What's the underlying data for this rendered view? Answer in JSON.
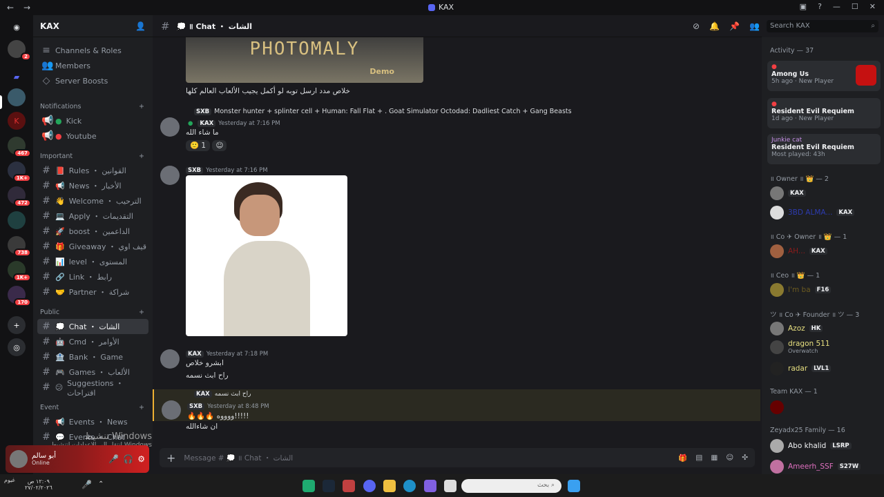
{
  "window": {
    "title": "KAX",
    "back": "←",
    "forward": "→"
  },
  "server": {
    "name": "KAX"
  },
  "guild_badges": [
    "2",
    "467",
    "1K+",
    "472",
    "738",
    "1K+",
    "170"
  ],
  "sidebar": {
    "top": [
      {
        "label": "Channels & Roles"
      },
      {
        "label": "Members"
      },
      {
        "label": "Server Boosts"
      }
    ],
    "notifications_cat": "Notifications",
    "notif": [
      {
        "label": "Kick"
      },
      {
        "label": "Youtube"
      }
    ],
    "important_cat": "Important",
    "important": [
      {
        "label": "Rules ・ القوانين",
        "emoji": "📕"
      },
      {
        "label": "News ・ الأخبار",
        "emoji": "📢"
      },
      {
        "label": "Welcome ・ الترحيب",
        "emoji": "👋"
      },
      {
        "label": "Apply ・ التقديمات",
        "emoji": "💻"
      },
      {
        "label": "boost ・ الداعمين",
        "emoji": "🚀"
      },
      {
        "label": "Giveaway ・ قيف اوي",
        "emoji": "🎁"
      },
      {
        "label": "level ・ المستوى",
        "emoji": "📊"
      },
      {
        "label": "Link ・ رابط",
        "emoji": "🔗"
      },
      {
        "label": "Partner ・ شراكة",
        "emoji": "🤝"
      }
    ],
    "public_cat": "Public",
    "public": [
      {
        "label": "Chat ・ الشات",
        "emoji": "💭"
      },
      {
        "label": "Cmd ・ الأوامر",
        "emoji": "🤖"
      },
      {
        "label": "Bank ・ Game",
        "emoji": "🏦"
      },
      {
        "label": "Games ・ الألعاب",
        "emoji": "🎮"
      },
      {
        "label": "Suggestions ・ اقتراحات",
        "emoji": "😕"
      }
    ],
    "event_cat": "Event",
    "event": [
      {
        "label": "Events ・ News",
        "emoji": "📢"
      },
      {
        "label": "Events ・ Chat",
        "emoji": "💬"
      }
    ]
  },
  "user": {
    "name": "أبو سالم",
    "status": "Online"
  },
  "watermark": {
    "line1": "تنشيط Windows",
    "line2": "انتقل إلى الإعدادات لتنشيط Windows"
  },
  "channel": {
    "title": "💭 ॥ Chat ・ الشات",
    "composer": "Message # 💭 ॥ Chat ・ الشات"
  },
  "search": {
    "placeholder": "Search KAX"
  },
  "messages": [
    {
      "text": "خلاص مدد ارسل توبه لو أكمل يجيب الألعاب العالم كلها",
      "image": "PHOTOMALY",
      "image_sub": "Demo"
    },
    {
      "reply": "Monster hunter + splinter cell + Human: Fall Flat + . Goat Simulator Octodad: Dadliest Catch + Gang Beasts",
      "reply_tag": "SXB",
      "tag": "KAX",
      "time": "Yesterday at 7:16 PM",
      "text": "ما شاء الله",
      "reaction_count": "1"
    },
    {
      "tag": "SXB",
      "time": "Yesterday at 7:16 PM"
    },
    {
      "tag": "KAX",
      "time": "Yesterday at 7:18 PM",
      "text": "ابشرو خلاص",
      "text2": "راح ابث نسمه"
    },
    {
      "reply": "راح ابث نسمه",
      "reply_tag": "KAX",
      "tag": "SXB",
      "time": "Yesterday at 8:48 PM",
      "text": "🔥🔥🔥 ووووه!!!!!",
      "text2": "ان شاءالله"
    }
  ],
  "members": {
    "activity_header": "Activity — 37",
    "activities": [
      {
        "game": "Among Us",
        "meta": "5h ago",
        "sub": "New Player"
      },
      {
        "game": "Resident Evil Requiem",
        "meta": "1d ago",
        "sub": "New Player"
      },
      {
        "name": "Junkie cat",
        "game": "Resident Evil Requiem",
        "meta": "Most played: 43h"
      }
    ],
    "groups": [
      {
        "header": "॥ Owner ॥ 👑 — 2",
        "members": [
          {
            "tag": "KAX"
          },
          {
            "name": "3BD ALMA...",
            "tag": "KAX"
          }
        ]
      },
      {
        "header": "॥ Co ✈ Owner ॥ 👑 — 1",
        "members": [
          {
            "name": "AH...",
            "tag": "KAX"
          }
        ]
      },
      {
        "header": "॥ Ceo ॥ 👑 — 1",
        "members": [
          {
            "name": "I'm ba",
            "tag": "F16"
          }
        ]
      },
      {
        "header": "ツ ॥ Co ✈ Founder ॥ ツ — 3",
        "members": [
          {
            "name": "Azoz",
            "tag": "HK"
          },
          {
            "name": "dragon 511",
            "sub": "Overwatch"
          },
          {
            "name": "radar",
            "tag": "LVL1"
          }
        ]
      },
      {
        "header": "Team KAX — 1",
        "members": [
          {
            "name": ""
          }
        ]
      },
      {
        "header": "Zeyadx25 Family — 16",
        "members": [
          {
            "name": "Abo khalid",
            "tag": "LSRP"
          },
          {
            "name": "Ameerh_SSF",
            "tag": "S27W"
          }
        ]
      }
    ]
  },
  "taskbar": {
    "search": "بحث",
    "time": "١٢:٠٩ ص",
    "date": "٢٧/٠٢/٢٠٢٦",
    "weather": "غيوم"
  }
}
